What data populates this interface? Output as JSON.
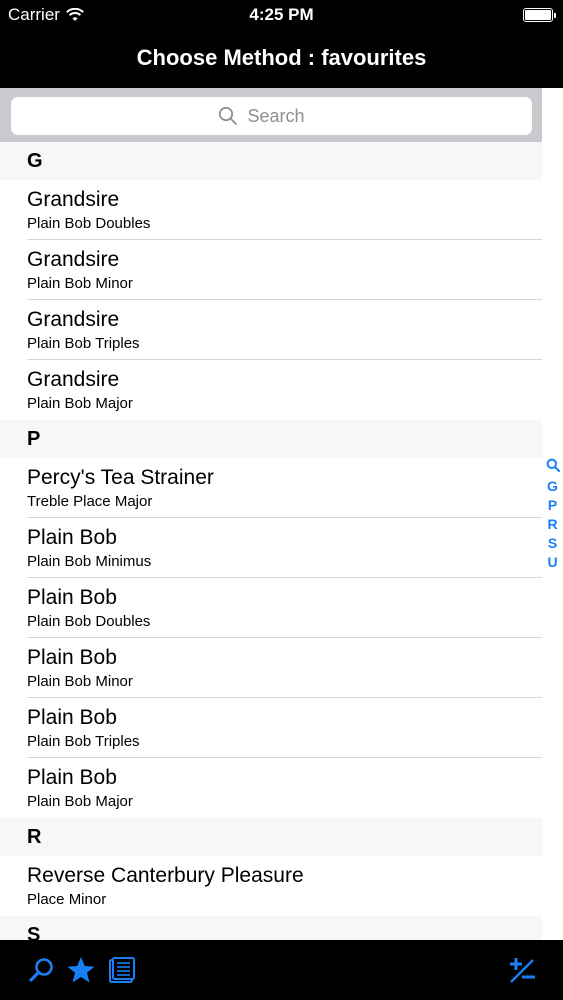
{
  "status": {
    "carrier": "Carrier",
    "time": "4:25 PM"
  },
  "nav": {
    "title": "Choose Method : favourites"
  },
  "search": {
    "placeholder": "Search"
  },
  "sections": [
    {
      "letter": "G",
      "rows": [
        {
          "title": "Grandsire",
          "subtitle": "Plain Bob Doubles"
        },
        {
          "title": "Grandsire",
          "subtitle": "Plain Bob Minor"
        },
        {
          "title": "Grandsire",
          "subtitle": "Plain Bob Triples"
        },
        {
          "title": "Grandsire",
          "subtitle": "Plain Bob Major"
        }
      ]
    },
    {
      "letter": "P",
      "rows": [
        {
          "title": "Percy's Tea Strainer",
          "subtitle": "Treble Place Major"
        },
        {
          "title": "Plain Bob",
          "subtitle": "Plain Bob Minimus"
        },
        {
          "title": "Plain Bob",
          "subtitle": "Plain Bob Doubles"
        },
        {
          "title": "Plain Bob",
          "subtitle": "Plain Bob Minor"
        },
        {
          "title": "Plain Bob",
          "subtitle": "Plain Bob Triples"
        },
        {
          "title": "Plain Bob",
          "subtitle": "Plain Bob Major"
        }
      ]
    },
    {
      "letter": "R",
      "rows": [
        {
          "title": "Reverse Canterbury Pleasure",
          "subtitle": "Place Minor"
        }
      ]
    },
    {
      "letter": "S",
      "rows": []
    }
  ],
  "index": [
    "G",
    "P",
    "R",
    "S",
    "U"
  ],
  "icons": {
    "search": "search-icon",
    "favourites": "star-icon",
    "library": "book-icon",
    "add_remove": "plus-minus-icon"
  },
  "colors": {
    "accent": "#1a7ff5",
    "bar": "#000000",
    "section_bg": "#f7f7f7",
    "search_bg": "#c9c9ce"
  }
}
